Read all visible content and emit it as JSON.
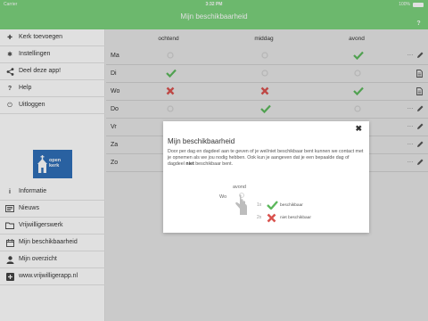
{
  "statusbar": {
    "carrier": "Carrier",
    "time": "3:32 PM",
    "battery": "100%"
  },
  "header": {
    "title": "Mijn beschikbaarheid",
    "help_label": "?"
  },
  "sidebar": {
    "items": [
      {
        "label": "Kerk toevoegen",
        "icon": "plus-icon"
      },
      {
        "label": "Instellingen",
        "icon": "gear-icon"
      },
      {
        "label": "Deel deze app!",
        "icon": "share-icon"
      },
      {
        "label": "Help",
        "icon": "question-icon"
      },
      {
        "label": "Uitloggen",
        "icon": "power-icon"
      },
      {
        "label": "Informatie",
        "icon": "info-icon"
      },
      {
        "label": "Nieuws",
        "icon": "news-icon"
      },
      {
        "label": "Vrijwilligerswerk",
        "icon": "folder-icon"
      },
      {
        "label": "Mijn beschikbaarheid",
        "icon": "calendar-icon"
      },
      {
        "label": "Mijn overzicht",
        "icon": "user-icon"
      },
      {
        "label": "www.vrijwilligerapp.nl",
        "icon": "external-plus-icon"
      }
    ],
    "logo": {
      "line1": "open",
      "line2": "kerk"
    }
  },
  "schedule": {
    "columns": [
      "ochtend",
      "middag",
      "avond"
    ],
    "rows": [
      {
        "day": "Ma",
        "cells": [
          "pending",
          "pending",
          "yes"
        ],
        "action": "edit"
      },
      {
        "day": "Di",
        "cells": [
          "yes",
          "pending",
          "pending"
        ],
        "action": "note"
      },
      {
        "day": "Wo",
        "cells": [
          "no",
          "no",
          "yes"
        ],
        "action": "note"
      },
      {
        "day": "Do",
        "cells": [
          "pending",
          "yes",
          "pending"
        ],
        "action": "edit"
      },
      {
        "day": "Vr",
        "cells": [
          "",
          "",
          ""
        ],
        "action": "edit"
      },
      {
        "day": "Za",
        "cells": [
          "",
          "",
          ""
        ],
        "action": "edit"
      },
      {
        "day": "Zo",
        "cells": [
          "",
          "",
          ""
        ],
        "action": "edit"
      }
    ],
    "colors": {
      "yes": "#5cb85c",
      "no": "#d9534f",
      "pending": "#cfcfcf"
    }
  },
  "modal": {
    "title": "Mijn beschikbaarheid",
    "close_label": "✖",
    "body_part1": "Door per dag en dagdeel aan te geven of je wel/niet beschikbaar bent kunnen we contact met je opnemen als we jou nodig hebben. Ook kun je aangeven dat je een bepaalde dag of dagdeel ",
    "body_bold": "niet",
    "body_part2": " beschikbaar bent.",
    "demo_column": "avond",
    "demo_day": "Wo",
    "legend": [
      {
        "key": "1x",
        "text": "beschikbaar"
      },
      {
        "key": "2x",
        "text": "niet beschikbaar"
      }
    ]
  }
}
